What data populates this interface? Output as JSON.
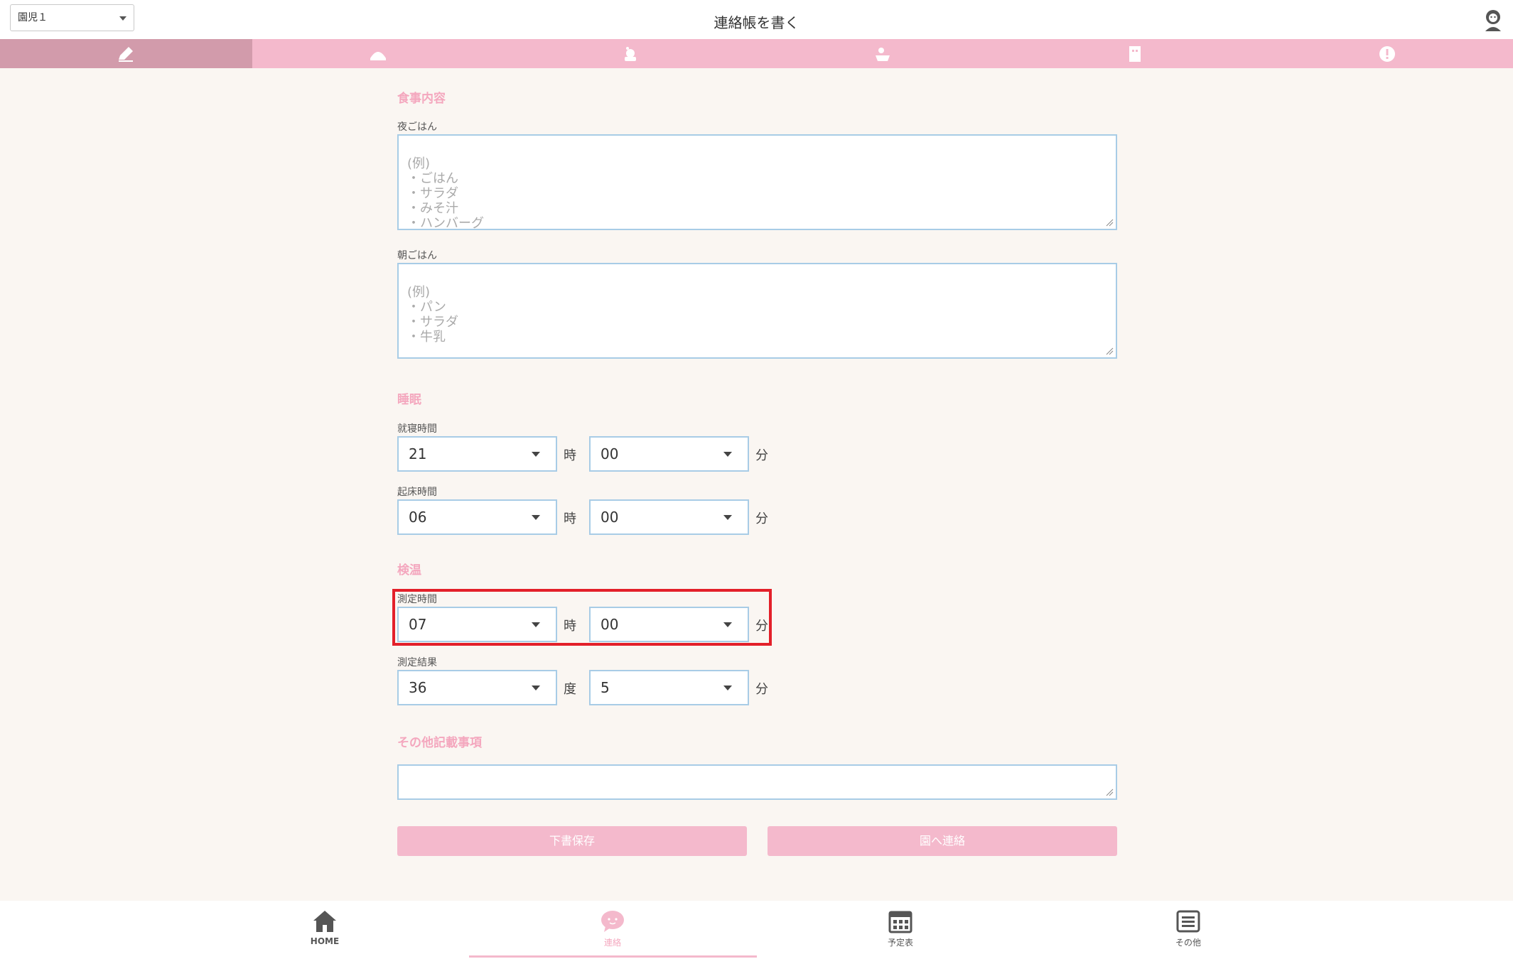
{
  "header": {
    "child_select": "園児１",
    "title": "連絡帳を書く"
  },
  "tabs": [
    {
      "icon": "pencil-icon",
      "active": true
    },
    {
      "icon": "food-icon",
      "active": false
    },
    {
      "icon": "sleep-icon",
      "active": false
    },
    {
      "icon": "bath-icon",
      "active": false
    },
    {
      "icon": "notebook-icon",
      "active": false
    },
    {
      "icon": "alert-icon",
      "active": false
    }
  ],
  "form": {
    "meal_title": "食事内容",
    "dinner_label": "夜ごはん",
    "dinner_placeholder": "(例)\n・ごはん\n・サラダ\n・みそ汁\n・ハンバーグ",
    "breakfast_label": "朝ごはん",
    "breakfast_placeholder": "(例)\n・パン\n・サラダ\n・牛乳",
    "sleep_title": "睡眠",
    "bedtime_label": "就寝時間",
    "bedtime_hour": "21",
    "bedtime_minute": "00",
    "wake_label": "起床時間",
    "wake_hour": "06",
    "wake_minute": "00",
    "temp_title": "検温",
    "measure_time_label": "測定時間",
    "measure_hour": "07",
    "measure_minute": "00",
    "measure_result_label": "測定結果",
    "temp_degree": "36",
    "temp_decimal": "5",
    "unit_hour": "時",
    "unit_minute": "分",
    "unit_degree": "度",
    "other_title": "その他記載事項",
    "draft_button": "下書保存",
    "send_button": "園へ連絡"
  },
  "bottom_nav": [
    {
      "label": "HOME",
      "icon": "home-icon",
      "active": false
    },
    {
      "label": "連絡",
      "icon": "chat-icon",
      "active": true
    },
    {
      "label": "予定表",
      "icon": "calendar-icon",
      "active": false
    },
    {
      "label": "その他",
      "icon": "menu-icon",
      "active": false
    }
  ],
  "colors": {
    "accent_pink": "#f4b9cc",
    "active_tab": "#d29bab",
    "section_title": "#f4a7be",
    "input_border": "#a8cce6",
    "highlight_red": "#e3202a",
    "background": "#faf6f2"
  }
}
